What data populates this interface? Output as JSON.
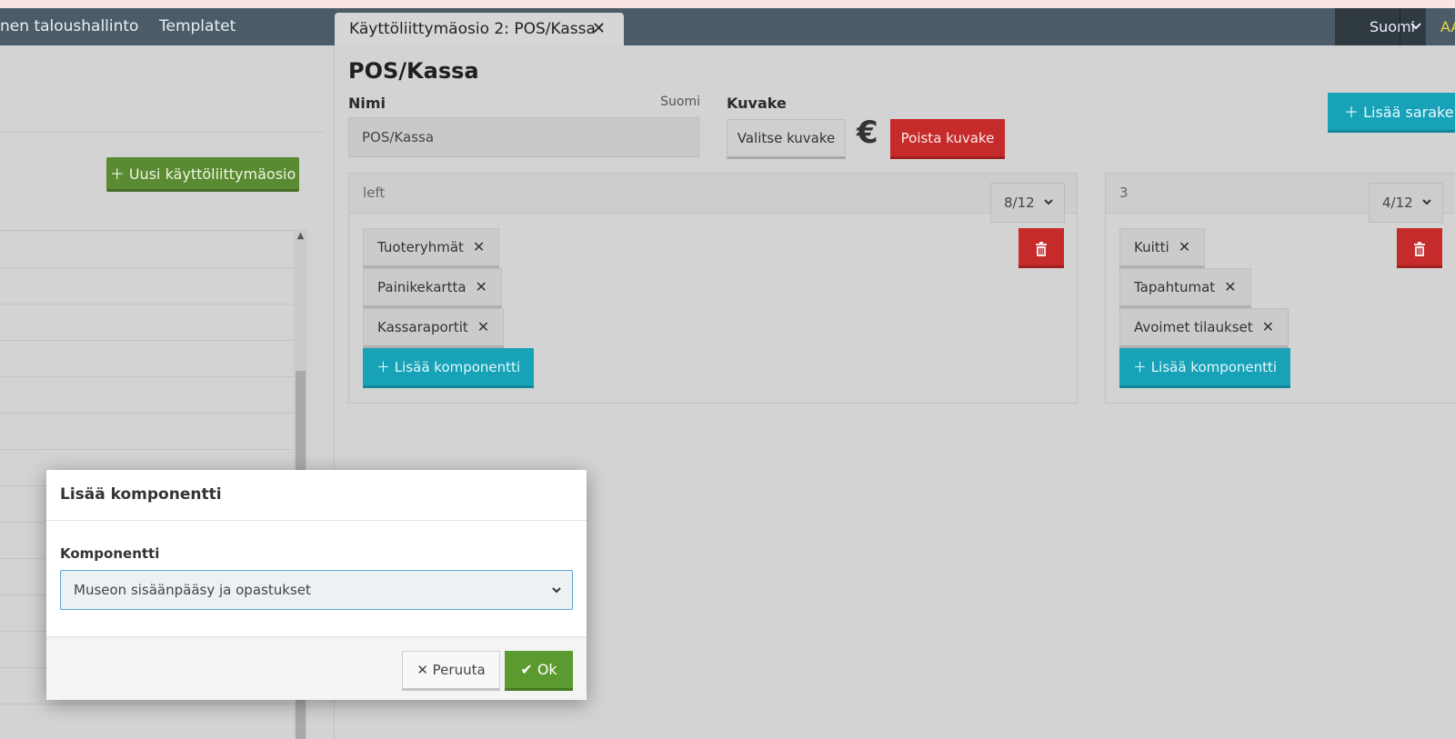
{
  "navbar": {
    "links": [
      "nen taloushallinto",
      "Templatet"
    ],
    "active_tab": {
      "label": "Käyttöliittymäosio 2: POS/Kassa",
      "close": "✕"
    },
    "language": "Suomi",
    "right_text": "AA"
  },
  "left_panel": {
    "new_button": "Uusi käyttöliittymäosio"
  },
  "main": {
    "title": "POS/Kassa",
    "name_label": "Nimi",
    "name_lang": "Suomi",
    "name_value": "POS/Kassa",
    "icon_label": "Kuvake",
    "choose_icon": "Valitse kuvake",
    "euro_icon": "€",
    "remove_icon": "Poista kuvake",
    "add_column": "Lisää sarake",
    "columns": [
      {
        "name": "left",
        "width": "8/12",
        "components": [
          "Tuoteryhmät",
          "Painikekartta",
          "Kassaraportit"
        ],
        "add_component": "Lisää komponentti"
      },
      {
        "name": "3",
        "width": "4/12",
        "components": [
          "Kuitti",
          "Tapahtumat",
          "Avoimet tilaukset"
        ],
        "add_component": "Lisää komponentti"
      }
    ]
  },
  "modal": {
    "title": "Lisää komponentti",
    "field_label": "Komponentti",
    "selected": "Museon sisäänpääsy ja opastukset",
    "cancel": "Peruuta",
    "ok": "Ok"
  },
  "colors": {
    "navbar": "#4b5c68",
    "green": "#5a8a32",
    "teal": "#17a2b8",
    "red": "#c62b2b"
  }
}
